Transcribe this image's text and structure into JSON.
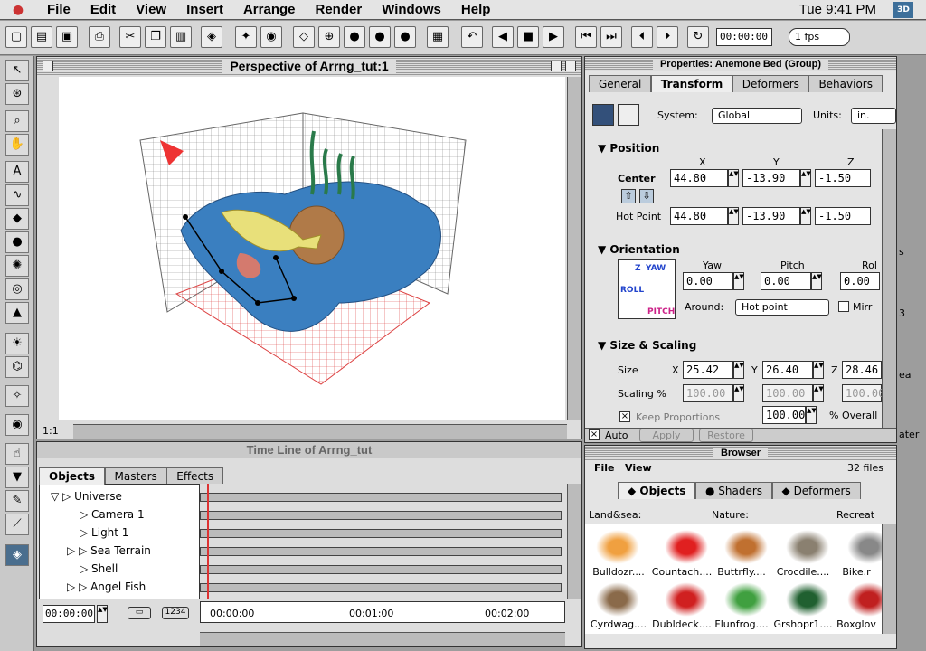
{
  "menu": {
    "apple": "",
    "items": [
      "File",
      "Edit",
      "View",
      "Insert",
      "Arrange",
      "Render",
      "Windows",
      "Help"
    ],
    "clock": "Tue 9:41 PM",
    "app_icon": "3D"
  },
  "toolbar": {
    "time": "00:00:00",
    "fps": "1 fps"
  },
  "viewport": {
    "title": "Perspective of Arrng_tut:1",
    "zoom": "1:1"
  },
  "properties": {
    "title": "Properties: Anemone Bed (Group)",
    "tabs": [
      "General",
      "Transform",
      "Deformers",
      "Behaviors"
    ],
    "active_tab": "Transform",
    "system_label": "System:",
    "system_value": "Global",
    "units_label": "Units:",
    "units_value": "in.",
    "position": {
      "header": "Position",
      "x": "X",
      "y": "Y",
      "z": "Z",
      "center_label": "Center",
      "center": [
        "44.80",
        "-13.90",
        "-1.50"
      ],
      "hot_label": "Hot Point",
      "hot": [
        "44.80",
        "-13.90",
        "-1.50"
      ]
    },
    "orientation": {
      "header": "Orientation",
      "yaw_label": "Yaw",
      "pitch_label": "Pitch",
      "roll_label": "Rol",
      "values": [
        "0.00",
        "0.00",
        "0.00"
      ],
      "around_label": "Around:",
      "around": "Hot point",
      "mirror": "Mirr",
      "gizmo": {
        "yaw": "YAW",
        "roll": "ROLL",
        "pitch": "PITCH",
        "z": "Z"
      }
    },
    "scaling": {
      "header": "Size & Scaling",
      "size_label": "Size",
      "scaling_label": "Scaling %",
      "x": "X",
      "y": "Y",
      "z": "Z",
      "size": [
        "25.42",
        "26.40",
        "28.46"
      ],
      "scale": [
        "100.00",
        "100.00",
        "100.00"
      ],
      "keep": "Keep Proportions",
      "overall": "100.00",
      "overall_label": "% Overall"
    },
    "footer": {
      "auto": "Auto",
      "apply": "Apply",
      "restore": "Restore"
    }
  },
  "timeline": {
    "title": "Time Line of Arrng_tut",
    "tabs": [
      "Objects",
      "Masters",
      "Effects"
    ],
    "rows": [
      "Universe",
      "Camera 1",
      "Light 1",
      "Sea Terrain",
      "Shell",
      "Angel Fish"
    ],
    "time": "00:00:00",
    "ruler": [
      "00:00:00",
      "00:01:00",
      "00:02:00"
    ],
    "btn1": "1234"
  },
  "browser": {
    "title": "Browser",
    "menu_file": "File",
    "menu_view": "View",
    "count": "32 files",
    "tabs": [
      "Objects",
      "Shaders",
      "Deformers"
    ],
    "cats": [
      "Land&sea:",
      "Nature:",
      "Recreat"
    ],
    "items": [
      "Bulldozr....",
      "Countach....",
      "Buttrfly....",
      "Crocdile....",
      "Bike.r",
      "Cyrdwag....",
      "Dubldeck....",
      "Flunfrog....",
      "Grshopr1....",
      "Boxglov"
    ]
  },
  "edge_text": [
    "s",
    "3",
    "ea",
    "ater"
  ],
  "colors": {
    "water": "#3a7fc0",
    "floor": "#d44",
    "shell": "#b07a48",
    "fish": "#e8e07a",
    "bg": "#9d9d9d"
  }
}
